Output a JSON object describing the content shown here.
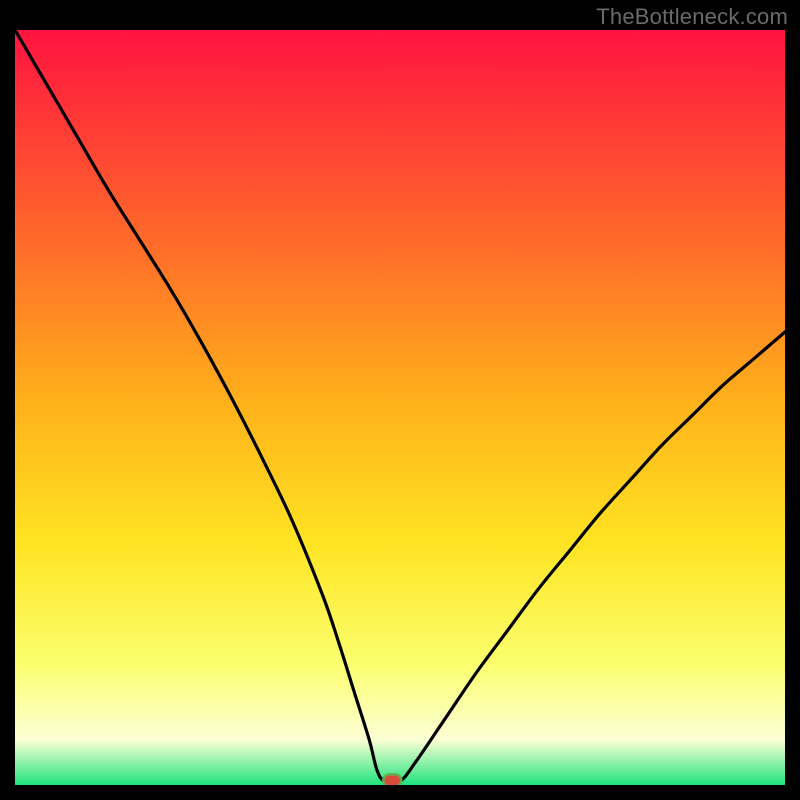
{
  "watermark": "TheBottleneck.com",
  "colors": {
    "gradient_top": "#ff1340",
    "gradient_mid1": "#ff6a2a",
    "gradient_mid2": "#ffb31a",
    "gradient_mid3": "#ffe423",
    "gradient_mid4": "#fbff6e",
    "gradient_pale": "#fdffd4",
    "gradient_bottom": "#1fe37d",
    "curve": "#000000",
    "marker_fill": "#d84a3a",
    "marker_stroke": "#6aa84f",
    "frame": "#000000"
  },
  "chart_data": {
    "type": "line",
    "title": "",
    "xlabel": "",
    "ylabel": "",
    "xlim": [
      0,
      100
    ],
    "ylim": [
      0,
      100
    ],
    "grid": false,
    "legend": null,
    "annotations": [],
    "series": [
      {
        "name": "bottleneck-curve",
        "x": [
          0,
          4,
          8,
          12,
          16,
          20,
          24,
          28,
          32,
          36,
          40,
          42,
          44,
          46,
          47,
          48,
          50,
          52,
          56,
          60,
          64,
          68,
          72,
          76,
          80,
          84,
          88,
          92,
          96,
          100
        ],
        "y": [
          100,
          93,
          86,
          79,
          72.5,
          66,
          59,
          51.5,
          43.5,
          35,
          25,
          19,
          12.5,
          6,
          2,
          0.5,
          0.5,
          3,
          9,
          15,
          20.5,
          26,
          31,
          36,
          40.5,
          45,
          49,
          53,
          56.5,
          60
        ]
      }
    ],
    "marker": {
      "x": 49,
      "y": 0.6
    },
    "gradient_stops": [
      {
        "pos": 0.0,
        "color": "#ff1340"
      },
      {
        "pos": 0.28,
        "color": "#ff6a2a"
      },
      {
        "pos": 0.5,
        "color": "#ffb31a"
      },
      {
        "pos": 0.68,
        "color": "#ffe423"
      },
      {
        "pos": 0.84,
        "color": "#fbff6e"
      },
      {
        "pos": 0.94,
        "color": "#fdffd4"
      },
      {
        "pos": 1.0,
        "color": "#1fe37d"
      }
    ]
  }
}
